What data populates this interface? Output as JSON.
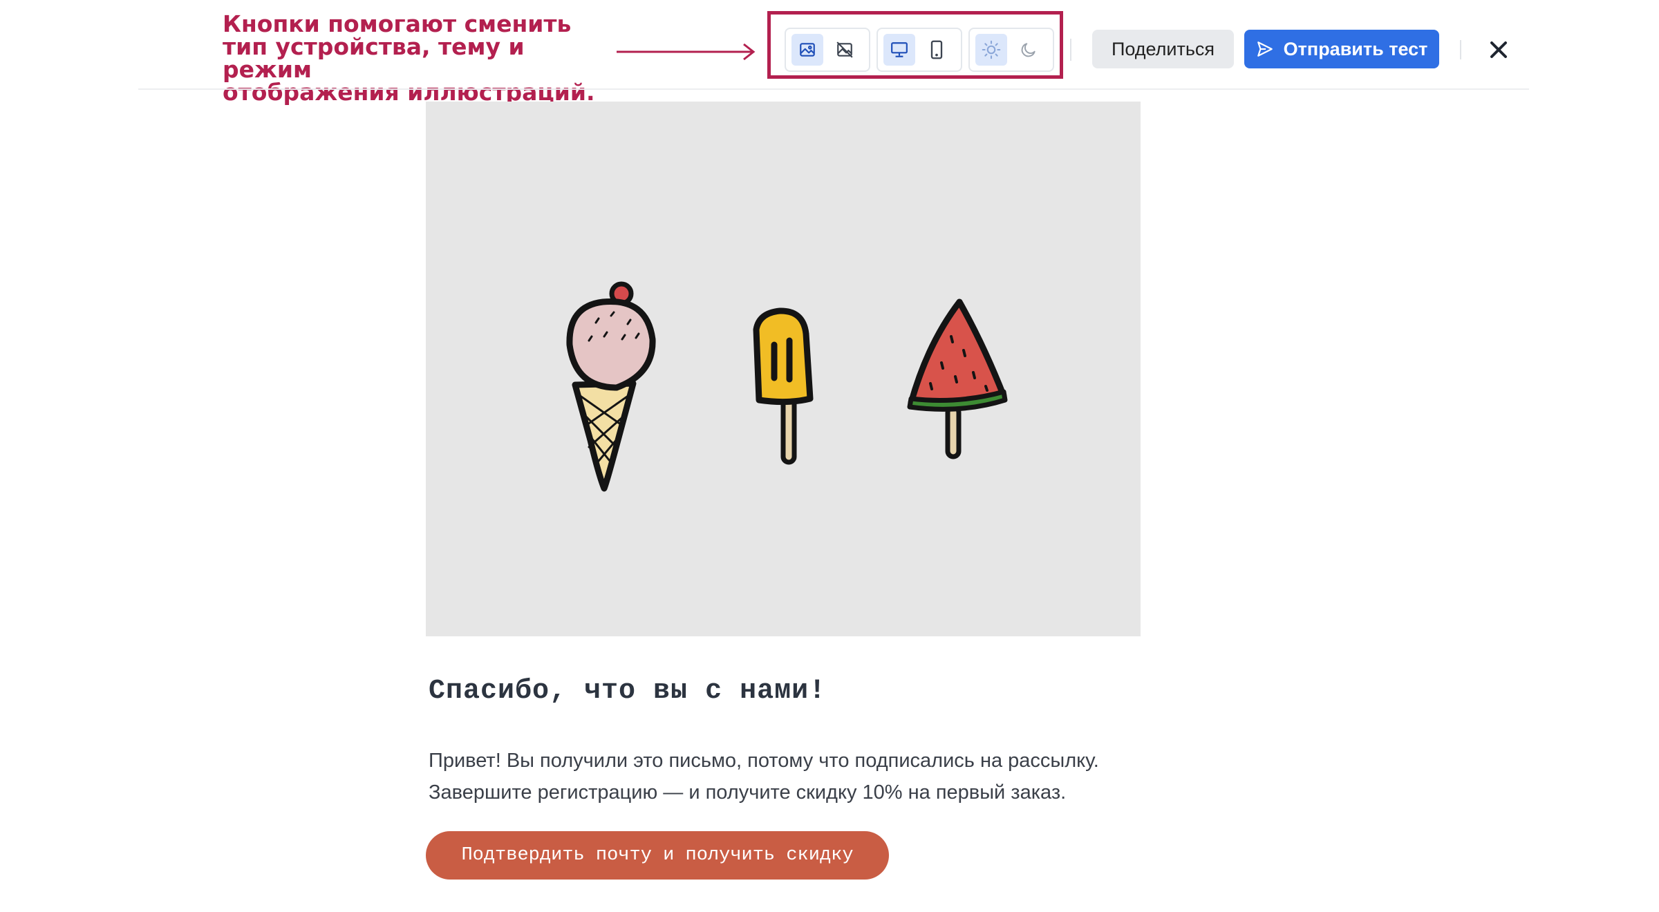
{
  "annotation": {
    "lines": [
      "Кнопки помогают сменить",
      "тип устройства, тему и режим",
      "отображения иллюстраций."
    ],
    "color": "#b3204f"
  },
  "toolbar": {
    "image_modes": [
      {
        "icon": "image-icon",
        "active": true
      },
      {
        "icon": "image-off-icon",
        "active": false
      }
    ],
    "devices": [
      {
        "icon": "desktop-icon",
        "active": true
      },
      {
        "icon": "mobile-icon",
        "active": false
      }
    ],
    "themes": [
      {
        "icon": "sun-icon",
        "active": true
      },
      {
        "icon": "moon-icon",
        "active": false
      }
    ],
    "share_label": "Поделиться",
    "send_label": "Отправить тест",
    "close_icon": "close-icon",
    "accent": "#2f6fe4"
  },
  "email": {
    "title": "Спасибо, что вы с нами!",
    "body_lines": [
      "Привет! Вы получили это письмо, потому что подписались на рассылку.",
      "Завершите регистрацию — и получите скидку 10% на первый заказ."
    ],
    "cta_label": "Подтвердить почту и получить скидку",
    "cta_color": "#c95d44",
    "hero_background": "#e6e6e6"
  }
}
